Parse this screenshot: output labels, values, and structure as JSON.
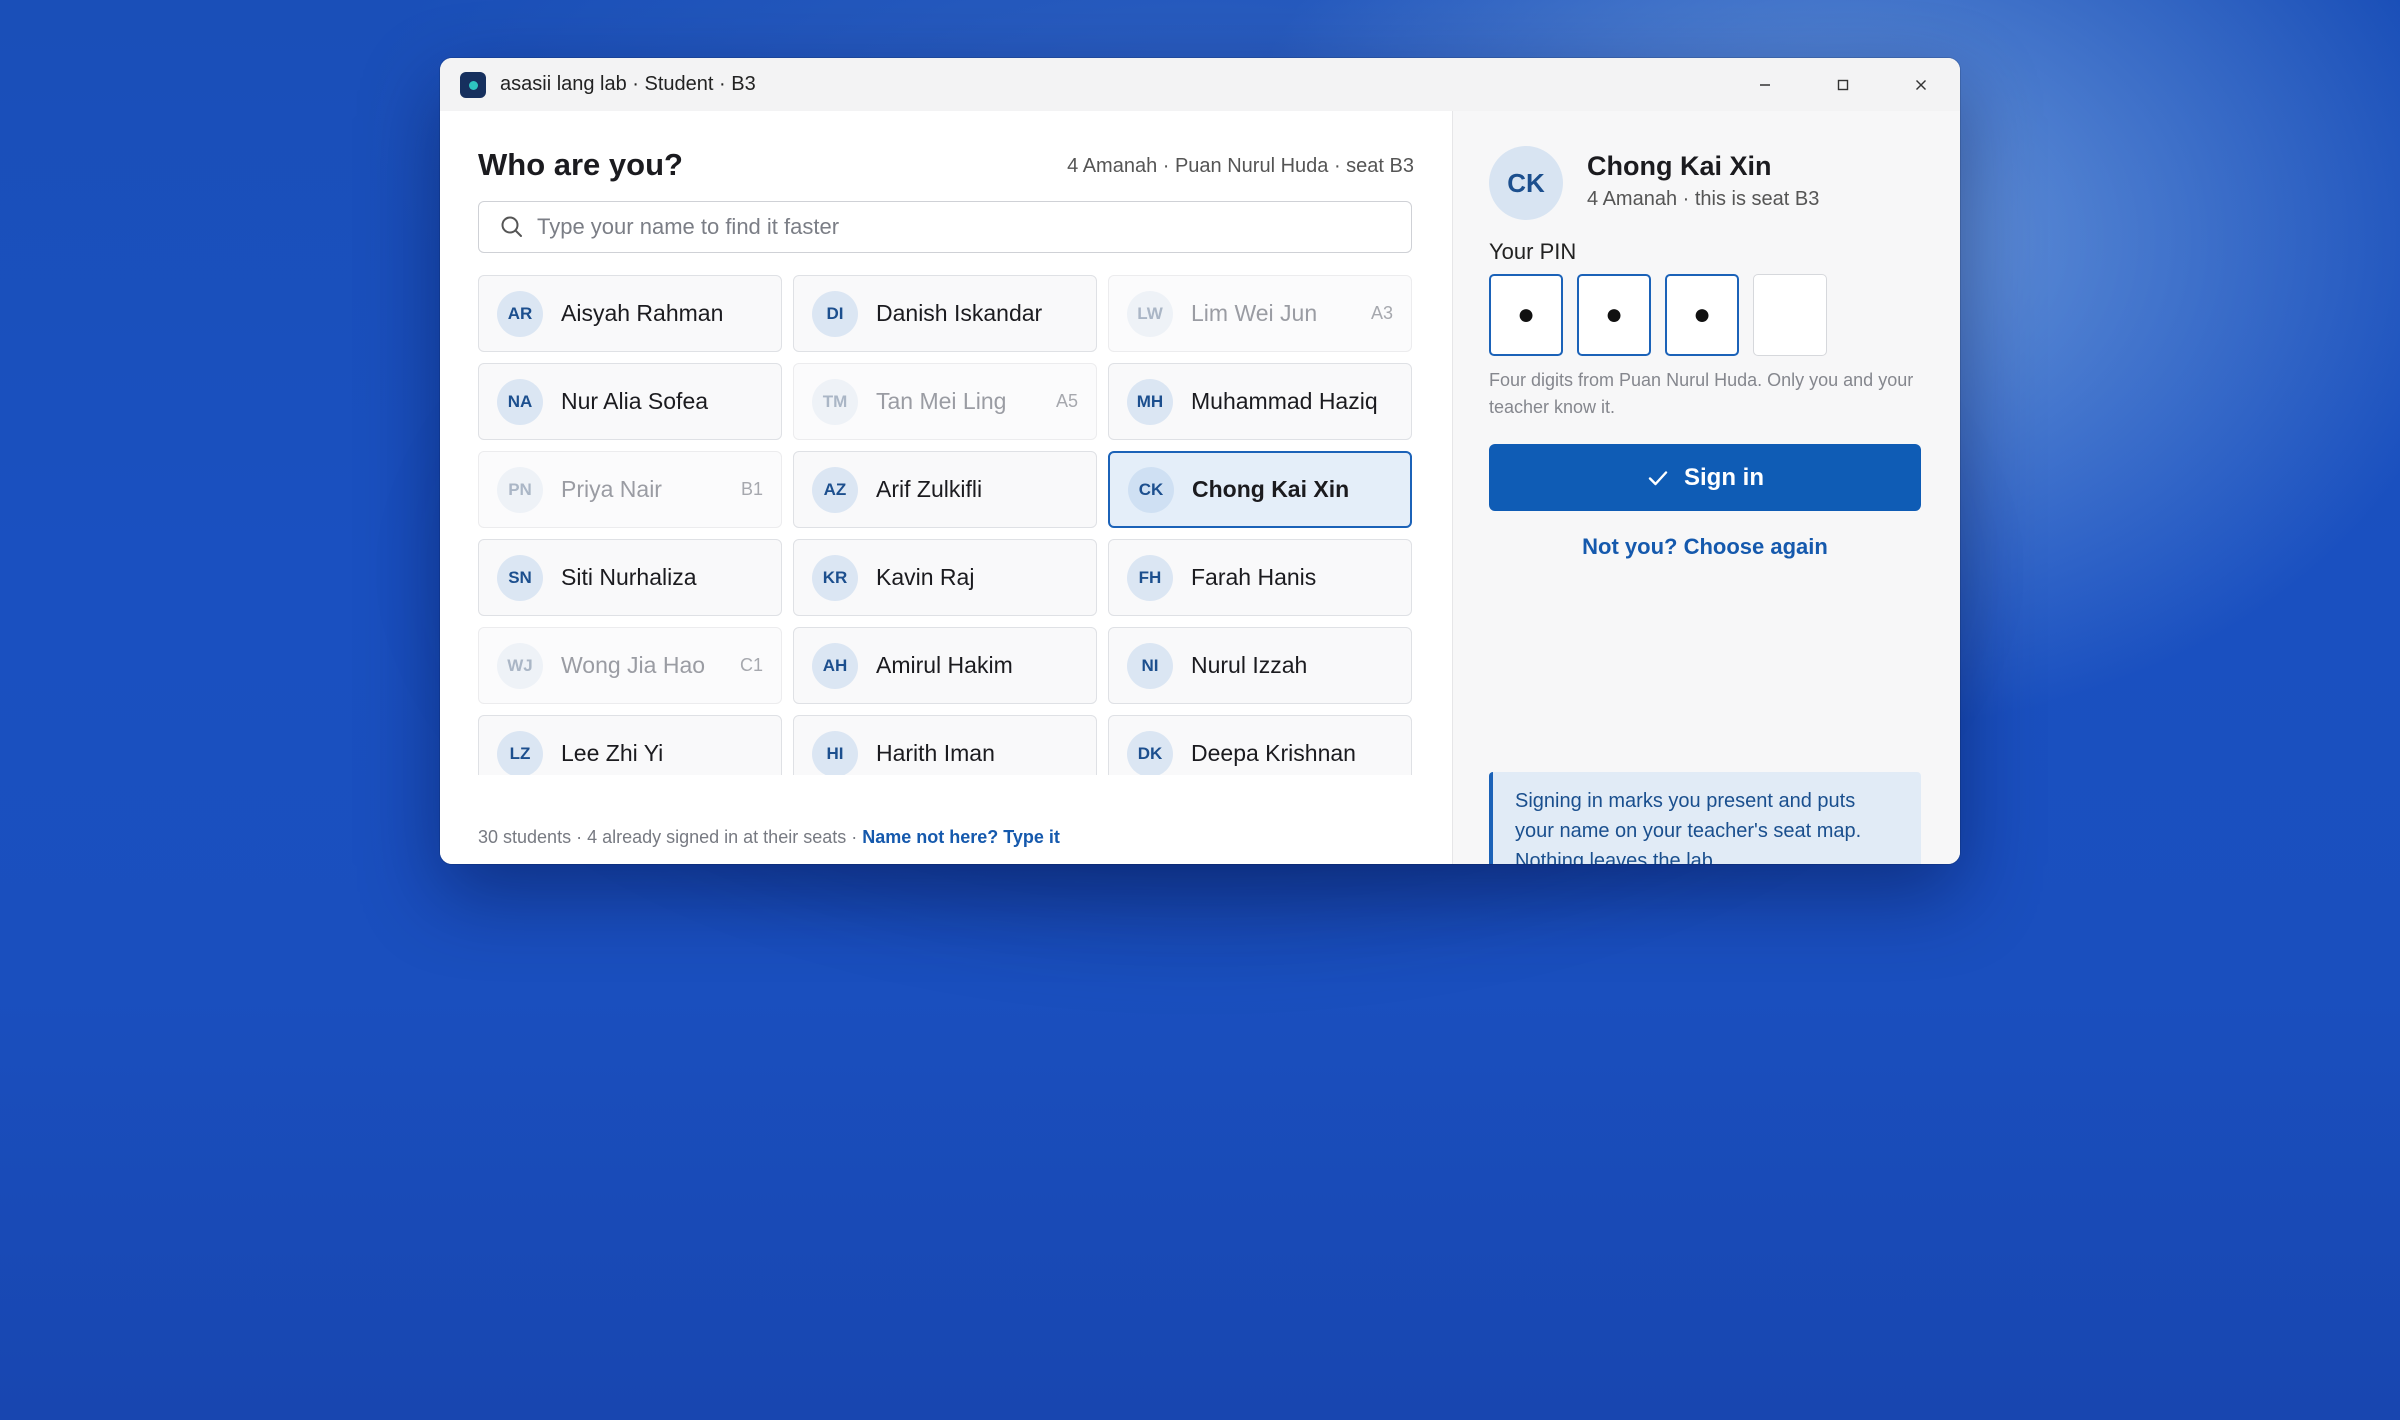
{
  "window": {
    "title": "asasii lang lab · Student · B3"
  },
  "left": {
    "heading": "Who are you?",
    "context": "4 Amanah · Puan Nurul Huda · seat B3",
    "search_placeholder": "Type your name to find it faster",
    "students": [
      {
        "initials": "AR",
        "name": "Aisyah Rahman",
        "seat": "",
        "state": "available"
      },
      {
        "initials": "DI",
        "name": "Danish Iskandar",
        "seat": "",
        "state": "available"
      },
      {
        "initials": "LW",
        "name": "Lim Wei Jun",
        "seat": "A3",
        "state": "taken"
      },
      {
        "initials": "NA",
        "name": "Nur Alia Sofea",
        "seat": "",
        "state": "available"
      },
      {
        "initials": "TM",
        "name": "Tan Mei Ling",
        "seat": "A5",
        "state": "taken"
      },
      {
        "initials": "MH",
        "name": "Muhammad Haziq",
        "seat": "",
        "state": "available"
      },
      {
        "initials": "PN",
        "name": "Priya Nair",
        "seat": "B1",
        "state": "taken"
      },
      {
        "initials": "AZ",
        "name": "Arif Zulkifli",
        "seat": "",
        "state": "available"
      },
      {
        "initials": "CK",
        "name": "Chong Kai Xin",
        "seat": "",
        "state": "selected"
      },
      {
        "initials": "SN",
        "name": "Siti Nurhaliza",
        "seat": "",
        "state": "available"
      },
      {
        "initials": "KR",
        "name": "Kavin Raj",
        "seat": "",
        "state": "available"
      },
      {
        "initials": "FH",
        "name": "Farah Hanis",
        "seat": "",
        "state": "available"
      },
      {
        "initials": "WJ",
        "name": "Wong Jia Hao",
        "seat": "C1",
        "state": "taken"
      },
      {
        "initials": "AH",
        "name": "Amirul Hakim",
        "seat": "",
        "state": "available"
      },
      {
        "initials": "NI",
        "name": "Nurul Izzah",
        "seat": "",
        "state": "available"
      },
      {
        "initials": "LZ",
        "name": "Lee Zhi Yi",
        "seat": "",
        "state": "available"
      },
      {
        "initials": "HI",
        "name": "Harith Iman",
        "seat": "",
        "state": "available"
      },
      {
        "initials": "DK",
        "name": "Deepa Krishnan",
        "seat": "",
        "state": "available"
      }
    ],
    "footer_text": "30 students · 4 already signed in at their seats · ",
    "footer_link": "Name not here? Type it"
  },
  "right": {
    "avatar_initials": "CK",
    "name": "Chong Kai Xin",
    "subtitle": "4 Amanah · this is seat B3",
    "pin_label": "Your PIN",
    "pin_digits": [
      "●",
      "●",
      "●",
      ""
    ],
    "pin_help": "Four digits from Puan Nurul Huda. Only you and your teacher know it.",
    "sign_in_label": "Sign in",
    "choose_again_label": "Not you? Choose again",
    "note": "Signing in marks you present and puts your name on your teacher's seat map. Nothing leaves the lab."
  },
  "colors": {
    "accent": "#0f5cb5",
    "desktop": "#1a4fb8"
  }
}
